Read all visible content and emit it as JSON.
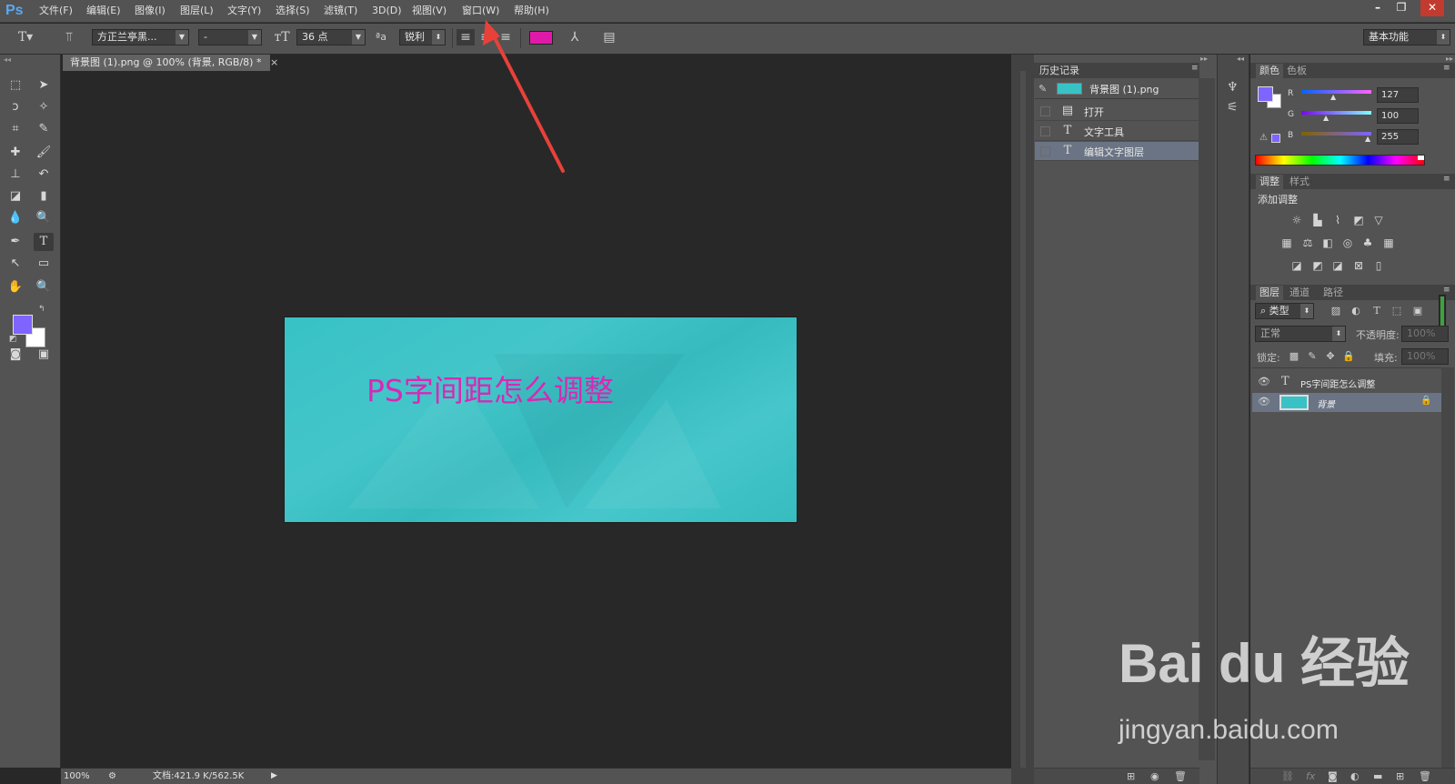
{
  "app": {
    "logo": "Ps"
  },
  "menu": {
    "items": [
      "文件(F)",
      "编辑(E)",
      "图像(I)",
      "图层(L)",
      "文字(Y)",
      "选择(S)",
      "滤镜(T)",
      "3D(D)",
      "视图(V)",
      "窗口(W)",
      "帮助(H)"
    ]
  },
  "window_controls": {
    "minimize": "–",
    "restore": "❐",
    "close": "✕"
  },
  "options": {
    "font_family": "方正兰亭黑...",
    "font_style": "-",
    "font_size": "36 点",
    "aa_label": "ªa",
    "antialias": "锐利",
    "text_color": "#e01aa8",
    "workspace": "基本功能"
  },
  "document": {
    "tab_title": "背景图 (1).png @ 100% (背景, RGB/8) *",
    "tab_close": "×",
    "image_text": "PS字间距怎么调整",
    "image_color": "#38c2c6",
    "text_color": "#d828b6"
  },
  "status": {
    "zoom": "100%",
    "doc_info": "文档:421.9 K/562.5K"
  },
  "history": {
    "tab": "历史记录",
    "snapshot": "背景图 (1).png",
    "items": [
      {
        "label": "打开",
        "icon": "document-icon"
      },
      {
        "label": "文字工具",
        "icon": "text-icon"
      },
      {
        "label": "编辑文字图层",
        "icon": "text-icon",
        "selected": true
      }
    ]
  },
  "color_panel": {
    "tabs": [
      "颜色",
      "色板"
    ],
    "foreground": "#7f64ff",
    "r_label": "R",
    "g_label": "G",
    "b_label": "B",
    "r": "127",
    "g": "100",
    "b": "255"
  },
  "adjust_panel": {
    "tabs": [
      "调整",
      "样式"
    ],
    "title": "添加调整"
  },
  "layers_panel": {
    "tabs": [
      "图层",
      "通道",
      "路径"
    ],
    "filter": "类型",
    "blend_mode": "正常",
    "opacity_label": "不透明度:",
    "opacity": "100%",
    "lock_label": "锁定:",
    "fill_label": "填充:",
    "fill": "100%",
    "layers": [
      {
        "name": "PS字间距怎么调整",
        "type": "text"
      },
      {
        "name": "背景",
        "type": "image",
        "selected": true
      }
    ]
  },
  "watermark": {
    "logo": "Bai du 经验",
    "url": "jingyan.baidu.com"
  }
}
